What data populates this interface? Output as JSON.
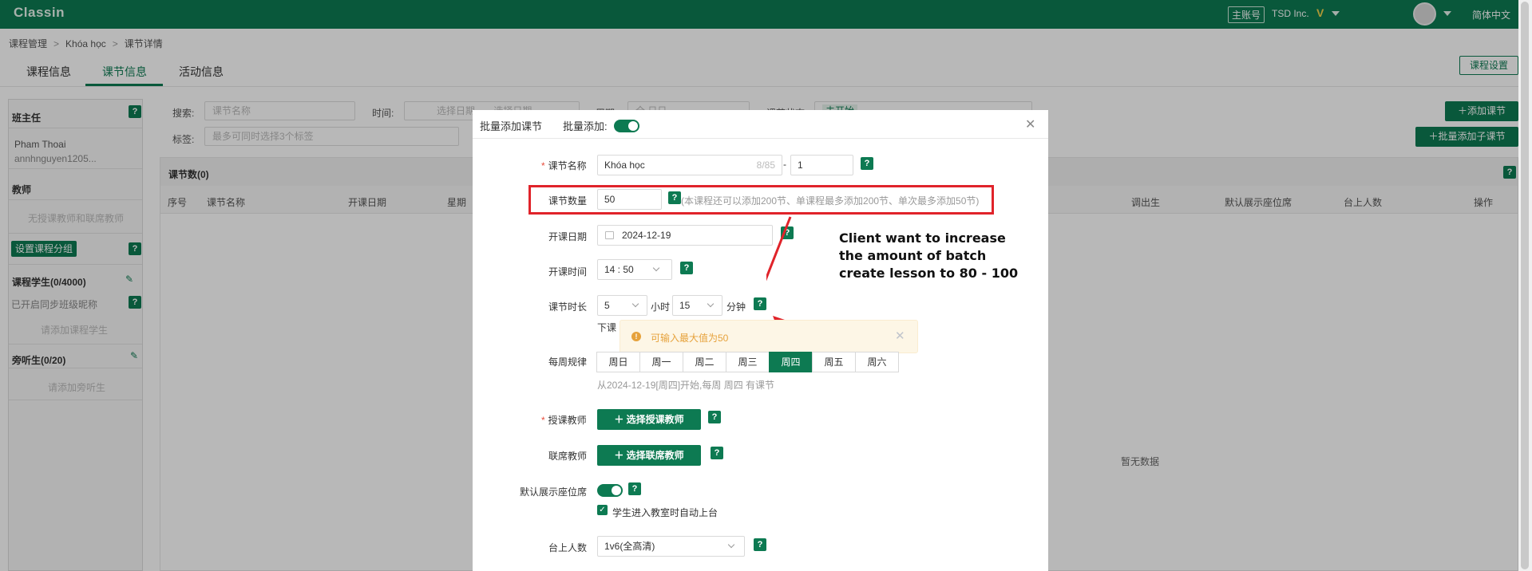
{
  "topbar": {
    "logo": "Classin",
    "account_badge": "主账号",
    "org_name": "TSD Inc.",
    "v_icon": "V",
    "language": "简体中文"
  },
  "breadcrumb": [
    "课程管理",
    "Khóa học",
    "课节详情"
  ],
  "tabs": [
    {
      "label": "课程信息",
      "active": false
    },
    {
      "label": "课节信息",
      "active": true
    },
    {
      "label": "活动信息",
      "active": false
    }
  ],
  "course_settings_button": "课程设置",
  "left_panel": {
    "head_teacher_title": "班主任",
    "head_teacher_name": "Pham Thoai",
    "head_teacher_email": "annhnguyen1205...",
    "teacher_title": "教师",
    "teacher_empty": "无授课教师和联席教师",
    "set_group_button": "设置课程分组",
    "students_title": "课程学生(0/4000)",
    "sync_nickname": "已开启同步班级昵称",
    "add_students": "请添加课程学生",
    "auditors_title": "旁听生(0/20)",
    "add_auditors": "请添加旁听生"
  },
  "filters": {
    "search_label": "搜索:",
    "search_placeholder": "课节名称",
    "time_label": "时间:",
    "start_placeholder": "选择日期",
    "end_placeholder": "选择日期",
    "week_label": "周期:",
    "week_placeholder": "全    日日",
    "status_label": "课节状态:",
    "status_tag": "未开始",
    "tag_label": "标签:",
    "tag_placeholder": "最多可同时选择3个标签"
  },
  "actions": {
    "add_lesson": "添加课节",
    "batch_add_sub": "批量添加子课节"
  },
  "table": {
    "count_label": "课节数(0)",
    "columns": [
      "序号",
      "课节名称",
      "开课日期",
      "星期",
      "调出生",
      "默认展示座位席",
      "台上人数",
      "操作"
    ],
    "empty_text": "暂无数据"
  },
  "modal": {
    "title": "批量添加课节",
    "batch_label": "批量添加:",
    "lesson_name_label": "课节名称",
    "lesson_name_value": "Khóa học",
    "lesson_name_counter": "8/85",
    "lesson_name_dash": "-",
    "lesson_number_value": "1",
    "lesson_count_label": "课节数量",
    "lesson_count_value": "50",
    "lesson_count_hint": "(本课程还可以添加200节、单课程最多添加200节、单次最多添加50节)",
    "start_date_label": "开课日期",
    "start_date_value": "2024-12-19",
    "start_time_label": "开课时间",
    "start_time_value": "14 : 50",
    "duration_label": "课节时长",
    "duration_hours": "5",
    "hours_unit": "小时",
    "duration_minutes": "15",
    "minutes_unit": "分钟",
    "end_prefix": "下课",
    "weekly_label": "每周规律",
    "days": [
      {
        "label": "周日",
        "active": false
      },
      {
        "label": "周一",
        "active": false
      },
      {
        "label": "周二",
        "active": false
      },
      {
        "label": "周三",
        "active": false
      },
      {
        "label": "周四",
        "active": true
      },
      {
        "label": "周五",
        "active": false
      },
      {
        "label": "周六",
        "active": false
      }
    ],
    "weekly_summary": "从2024-12-19[周四]开始,每周 周四 有课节",
    "teacher_label": "授课教师",
    "teacher_button": "选择授课教师",
    "co_teacher_label": "联席教师",
    "co_teacher_button": "选择联席教师",
    "seat_label": "默认展示座位席",
    "auto_stage_label": "学生进入教室时自动上台",
    "stage_count_label": "台上人数",
    "stage_count_value": "1v6(全高清)",
    "help": "?"
  },
  "alert": {
    "text": "可输入最大值为50"
  },
  "annotation": {
    "text": "Client want to increase the amount of batch create lesson to 80 - 100",
    "color": "#e0232a"
  },
  "colors": {
    "brand": "#0d7a52",
    "warning": "#e6a23c"
  }
}
